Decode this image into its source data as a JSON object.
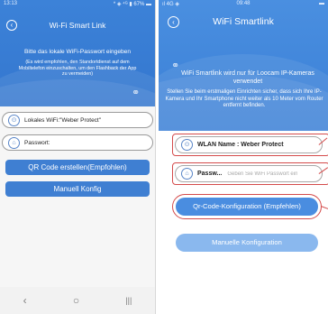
{
  "left": {
    "status": {
      "time": "13:13",
      "right": "* ◈ ⁴ᴳ ▮ 67% ▬"
    },
    "title": "Wi-Fi Smart Link",
    "message": "Bitte das lokale WiFi-Passwort eingeben",
    "note": "(Es wird empfohlen, den Standortdienst auf dem Mobiltelefon einzuschalten, um den Flashback der App zu vermeiden)",
    "wifi_field": "Lokales WiFi:\"Weber Protect\"",
    "password_field": "Passwort:",
    "qr_button": "QR Code erstellen(Empfohlen)",
    "manual_button": "Manuell Konfig",
    "nav": {
      "back": "‹",
      "home": "○",
      "recents": "|||"
    }
  },
  "right": {
    "status": {
      "left": "ıl 4G ◈",
      "time": "09:48",
      "right": "▬"
    },
    "title": "WiFi Smartlink",
    "message_main": "WiFi Smartlink wird nur für Loocam IP-Kameras verwendet",
    "message_detail": "Stellen Sie beim erstmaligen Einrichten sicher, dass sich Ihre IP-Kamera und Ihr Smartphone nicht weiter als 10 Meter vom Router entfernt befinden.",
    "wlan_field": "WLAN Name : Weber Protect",
    "password_label": "Passw...",
    "password_placeholder": "Geben Sie WiFi Passwort ein",
    "qr_button": "Qr-Code-Konfiguration (Empfehlen)",
    "manual_button": "Manuelle Konfiguration"
  },
  "colors": {
    "primary": "#3f7fd2",
    "highlight": "#d44b4b"
  }
}
